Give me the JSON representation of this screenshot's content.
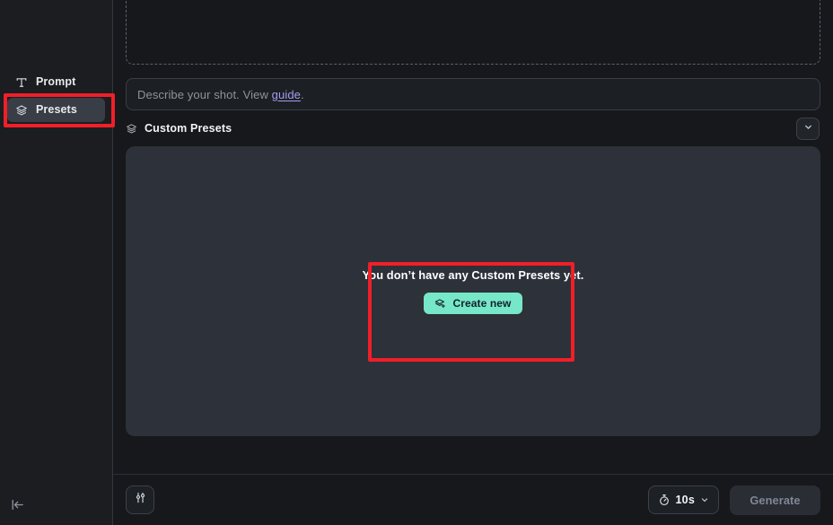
{
  "sidebar": {
    "items": [
      {
        "label": "Prompt",
        "icon": "text-type-icon",
        "active": false
      },
      {
        "label": "Presets",
        "icon": "layers-icon",
        "active": true
      }
    ],
    "collapse_icon": "collapse-panel-icon"
  },
  "dropzone": {
    "label": ""
  },
  "prompt": {
    "placeholder_prefix": "Describe your shot. View ",
    "link_text": "guide",
    "placeholder_suffix": ".",
    "value": ""
  },
  "section": {
    "title": "Custom Presets",
    "icon": "layers-icon",
    "collapse_icon": "chevron-down-icon"
  },
  "empty_state": {
    "message": "You don’t have any Custom Presets yet.",
    "button_label": "Create new",
    "button_icon": "layers-plus-icon"
  },
  "bottom_bar": {
    "settings_icon": "sliders-icon",
    "duration": {
      "icon": "stopwatch-icon",
      "value": "10s",
      "chevron": "chevron-down-icon"
    },
    "generate_label": "Generate",
    "generate_disabled": true
  },
  "colors": {
    "page_bg": "#16181c",
    "sidebar_bg": "#1b1d21",
    "panel_bg": "#2d313a",
    "accent_mint": "#76e7c8",
    "link_purple": "#a79bf0",
    "annotation_red": "#f01f28",
    "active_item_bg": "#393d45"
  }
}
